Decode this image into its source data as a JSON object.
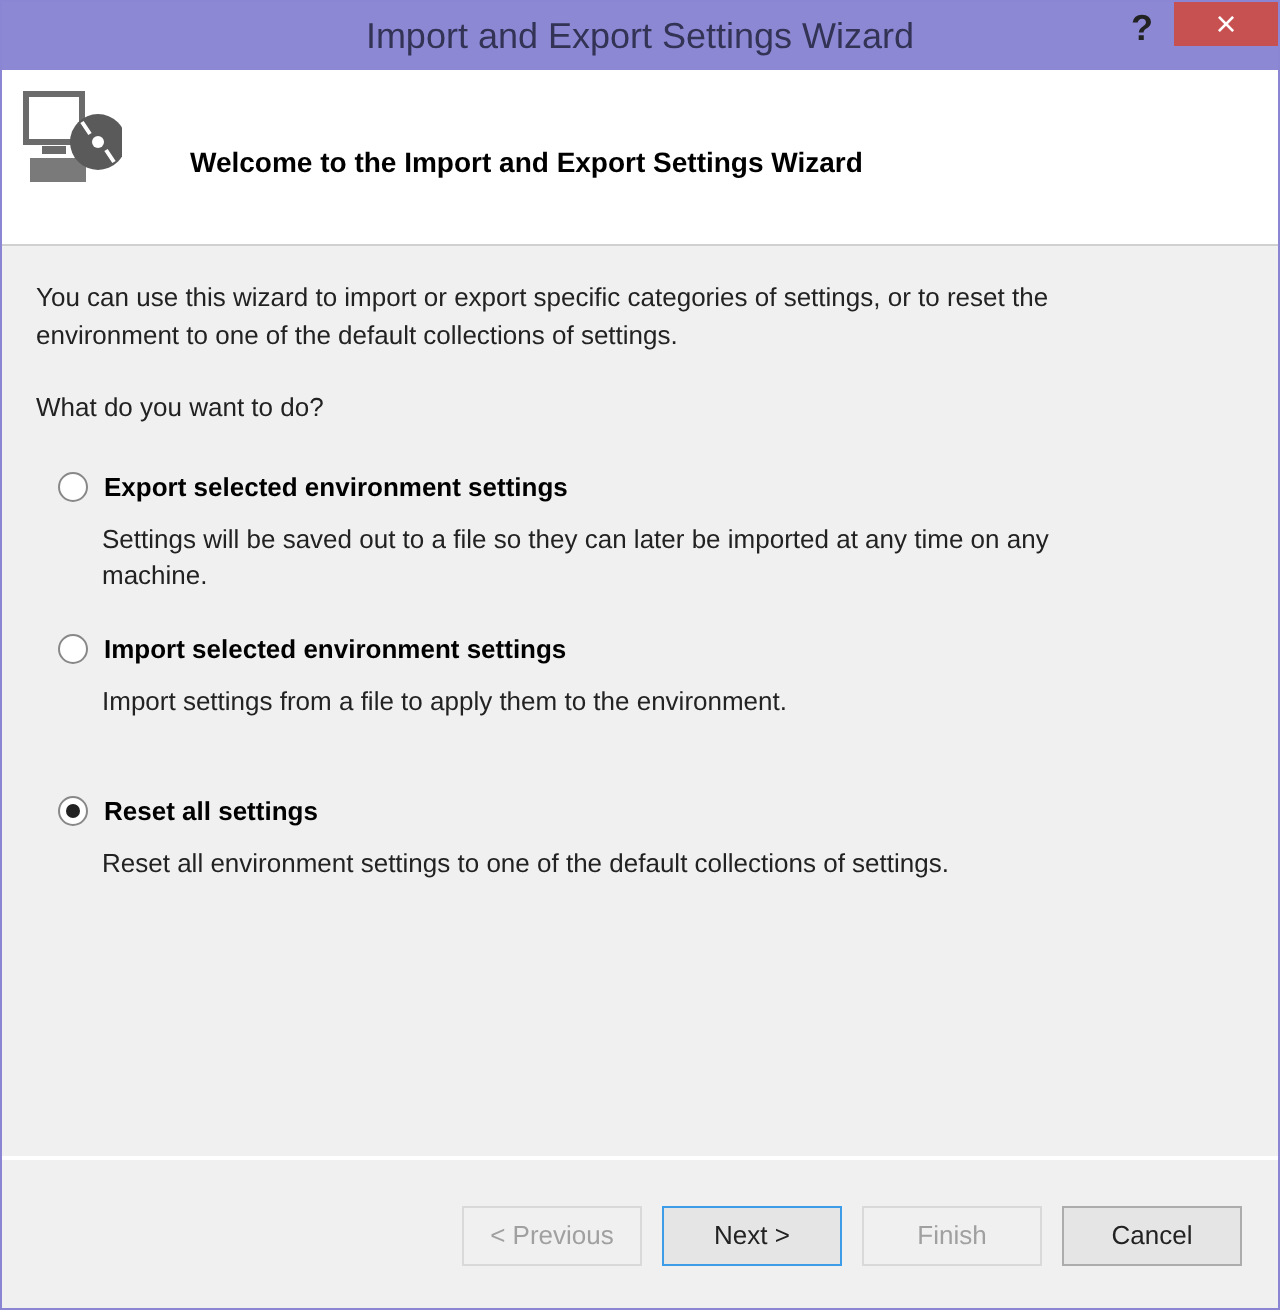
{
  "window": {
    "title": "Import and Export Settings Wizard",
    "help": "?",
    "close": "×"
  },
  "header": {
    "title": "Welcome to the Import and Export Settings Wizard"
  },
  "intro": "You can use this wizard to import or export specific categories of settings, or to reset the environment to one of the default collections of settings.",
  "question": "What do you want to do?",
  "options": [
    {
      "label": "Export selected environment settings",
      "description": "Settings will be saved out to a file so they can later be imported at any time on any machine.",
      "selected": false
    },
    {
      "label": "Import selected environment settings",
      "description": "Import settings from a file to apply them to the environment.",
      "selected": false
    },
    {
      "label": "Reset all settings",
      "description": "Reset all environment settings to one of the default collections of settings.",
      "selected": true
    }
  ],
  "buttons": [
    {
      "label": "< Previous",
      "disabled": true,
      "default": false
    },
    {
      "label": "Next >",
      "disabled": false,
      "default": true
    },
    {
      "label": "Finish",
      "disabled": true,
      "default": false
    },
    {
      "label": "Cancel",
      "disabled": false,
      "default": false
    }
  ]
}
